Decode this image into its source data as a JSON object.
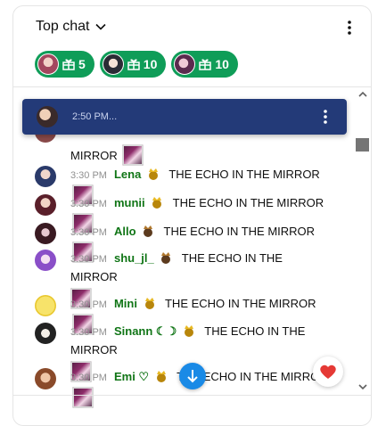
{
  "header": {
    "title": "Top chat"
  },
  "tickers": [
    {
      "count": "5"
    },
    {
      "count": "10"
    },
    {
      "count": "10"
    }
  ],
  "pinned": {
    "time": "2:50 PM..."
  },
  "messages": [
    {
      "time": "",
      "author": "",
      "text": "",
      "tail": "MIRROR"
    },
    {
      "time": "3:30 PM",
      "author": "Lena",
      "text": "THE ECHO IN THE MIRROR"
    },
    {
      "time": "3:30 PM",
      "author": "munii",
      "text": "THE ECHO IN THE MIRROR"
    },
    {
      "time": "3:30 PM",
      "author": "Allo",
      "text": "THE ECHO IN THE MIRROR"
    },
    {
      "time": "3:30 PM",
      "author": "shu_jl_",
      "text": "THE ECHO IN THE MIRROR"
    },
    {
      "time": "3:30 PM",
      "author": "Mini",
      "text": "THE ECHO IN THE MIRROR"
    },
    {
      "time": "3:30 PM",
      "author": "Sinann ☾☽",
      "text": "THE ECHO IN THE MIRROR"
    },
    {
      "time": "3:30 PM",
      "author": "Emi ♡",
      "text": "THE ECHO IN THE MIRROR"
    }
  ],
  "colors": {
    "accent_green": "#0f9d58",
    "author_green": "#107516",
    "pinned_bg": "#233a78",
    "jump_blue": "#1a8ae6"
  }
}
